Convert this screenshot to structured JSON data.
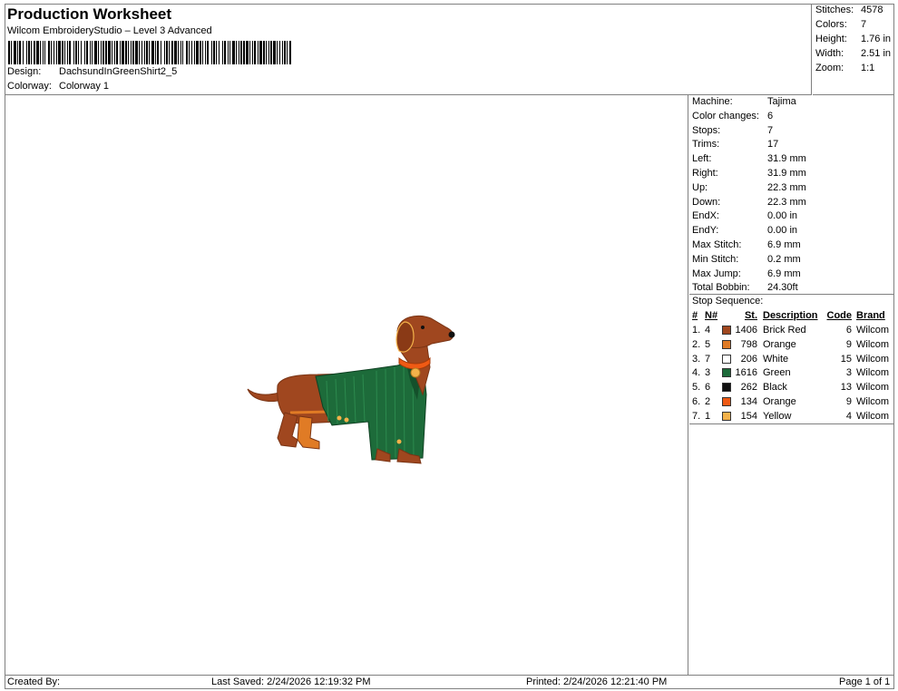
{
  "header": {
    "title": "Production Worksheet",
    "subtitle": "Wilcom EmbroideryStudio – Level 3 Advanced",
    "design_label": "Design:",
    "design_value": "DachsundInGreenShirt2_5",
    "colorway_label": "Colorway:",
    "colorway_value": "Colorway 1"
  },
  "stats": [
    {
      "label": "Stitches:",
      "value": "4578"
    },
    {
      "label": "Colors:",
      "value": "7"
    },
    {
      "label": "Height:",
      "value": "1.76 in"
    },
    {
      "label": "Width:",
      "value": "2.51 in"
    },
    {
      "label": "Zoom:",
      "value": "1:1"
    }
  ],
  "machine_info": [
    {
      "label": "Machine:",
      "value": "Tajima"
    },
    {
      "label": "Color changes:",
      "value": "6"
    },
    {
      "label": "Stops:",
      "value": "7"
    },
    {
      "label": "Trims:",
      "value": "17"
    },
    {
      "label": "Left:",
      "value": "31.9 mm"
    },
    {
      "label": "Right:",
      "value": "31.9 mm"
    },
    {
      "label": "Up:",
      "value": "22.3 mm"
    },
    {
      "label": "Down:",
      "value": "22.3 mm"
    },
    {
      "label": "EndX:",
      "value": "0.00 in"
    },
    {
      "label": "EndY:",
      "value": "0.00 in"
    },
    {
      "label": "Max Stitch:",
      "value": "6.9 mm"
    },
    {
      "label": "Min Stitch:",
      "value": "0.2 mm"
    },
    {
      "label": "Max Jump:",
      "value": "6.9 mm"
    },
    {
      "label": "Total Bobbin:",
      "value": "24.30ft"
    }
  ],
  "stop_sequence": {
    "title": "Stop Sequence:",
    "headers": {
      "num": "#",
      "n": "N#",
      "st": "St.",
      "desc": "Description",
      "code": "Code",
      "brand": "Brand"
    },
    "rows": [
      {
        "num": "1.",
        "n": "4",
        "color": "#A0471F",
        "st": "1406",
        "desc": "Brick Red",
        "code": "6",
        "brand": "Wilcom"
      },
      {
        "num": "2.",
        "n": "5",
        "color": "#E07B25",
        "st": "798",
        "desc": "Orange",
        "code": "9",
        "brand": "Wilcom"
      },
      {
        "num": "3.",
        "n": "7",
        "color": "#FFFFFF",
        "st": "206",
        "desc": "White",
        "code": "15",
        "brand": "Wilcom"
      },
      {
        "num": "4.",
        "n": "3",
        "color": "#1D6B3A",
        "st": "1616",
        "desc": "Green",
        "code": "3",
        "brand": "Wilcom"
      },
      {
        "num": "5.",
        "n": "6",
        "color": "#111111",
        "st": "262",
        "desc": "Black",
        "code": "13",
        "brand": "Wilcom"
      },
      {
        "num": "6.",
        "n": "2",
        "color": "#F05A14",
        "st": "134",
        "desc": "Orange",
        "code": "9",
        "brand": "Wilcom"
      },
      {
        "num": "7.",
        "n": "1",
        "color": "#F4B24A",
        "st": "154",
        "desc": "Yellow",
        "code": "4",
        "brand": "Wilcom"
      }
    ]
  },
  "footer": {
    "created": "Created By:",
    "saved": "Last Saved: 2/24/2026 12:19:32 PM",
    "printed": "Printed: 2/24/2026 12:21:40 PM",
    "page": "Page 1 of 1"
  }
}
